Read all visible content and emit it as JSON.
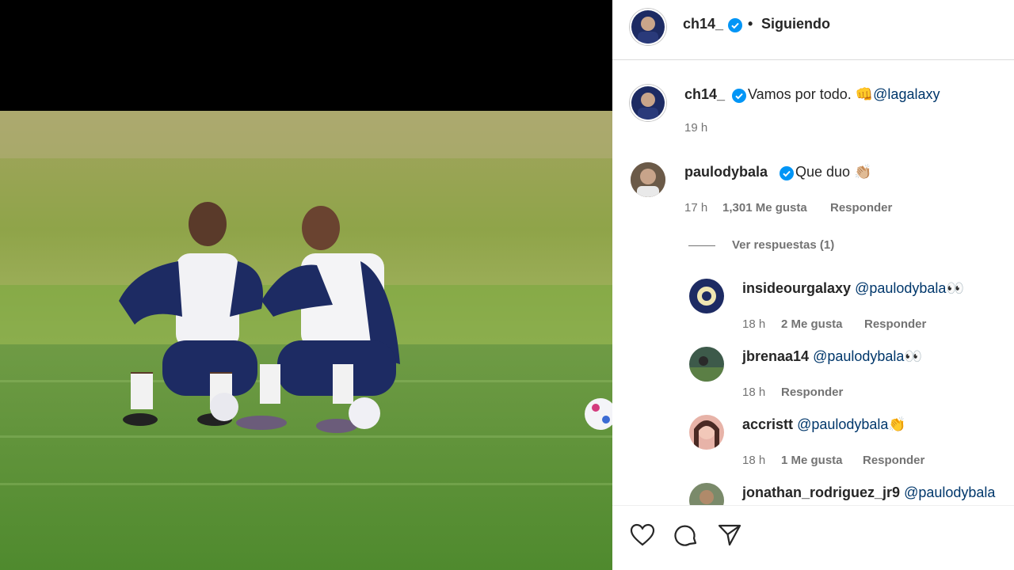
{
  "post": {
    "author": "ch14_",
    "follow_status": "Siguiendo",
    "caption_text": "Vamos por todo. 👊",
    "caption_mention": "@lagalaxy",
    "caption_time": "19 h"
  },
  "comments": [
    {
      "user": "paulodybala",
      "verified": true,
      "text": "Que duo 👏🏼",
      "time": "17 h",
      "likes": "1,301 Me gusta",
      "reply": "Responder",
      "view_replies": "Ver respuestas (1)"
    }
  ],
  "replies": [
    {
      "user": "insideourgalaxy",
      "mention": "@paulodybala",
      "emoji": "👀",
      "time": "18 h",
      "likes": "2 Me gusta",
      "reply": "Responder"
    },
    {
      "user": "jbrenaa14",
      "mention": "@paulodybala",
      "emoji": "👀",
      "time": "18 h",
      "likes": "",
      "reply": "Responder"
    },
    {
      "user": "accristt",
      "mention": "@paulodybala",
      "emoji": "👏",
      "time": "18 h",
      "likes": "1 Me gusta",
      "reply": "Responder"
    },
    {
      "user": "jonathan_rodriguez_jr9",
      "mention": "@paulodybala",
      "emoji": "",
      "time": "",
      "likes": "",
      "reply": ""
    }
  ],
  "colors": {
    "verified_blue": "#0095f6",
    "mention": "#00376b",
    "meta": "#737373"
  },
  "icons": [
    "heart-icon",
    "comment-icon",
    "share-icon",
    "verified-icon"
  ]
}
